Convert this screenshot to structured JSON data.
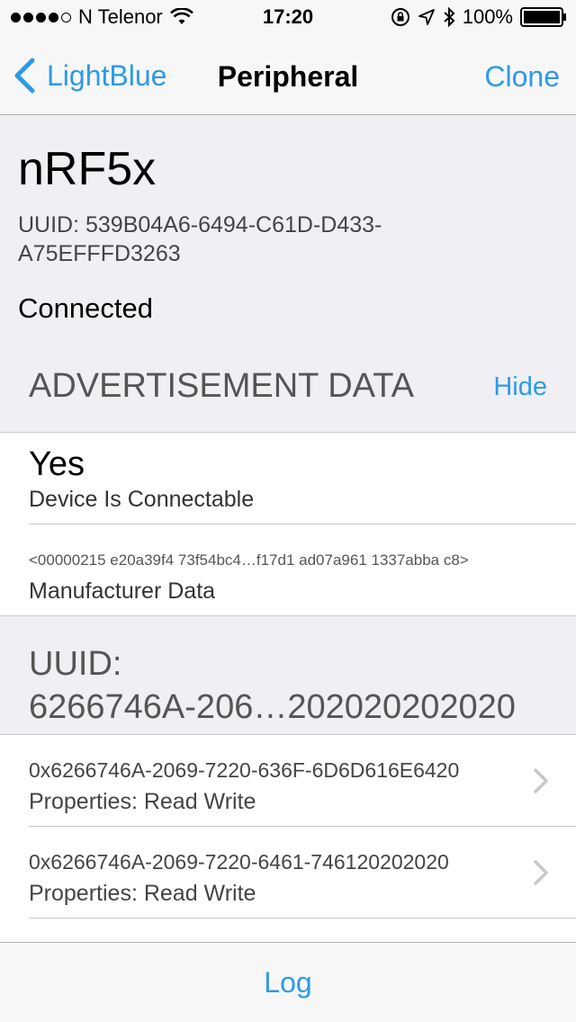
{
  "status_bar": {
    "carrier": "N Telenor",
    "time": "17:20",
    "battery": "100%",
    "signal_bars_filled": 4,
    "signal_bars_total": 5
  },
  "nav": {
    "back_label": "LightBlue",
    "title": "Peripheral",
    "clone_label": "Clone"
  },
  "device": {
    "name": "nRF5x",
    "uuid_line1": "UUID: 539B04A6-6494-C61D-D433-",
    "uuid_line2": "A75EFFFD3263",
    "status": "Connected"
  },
  "advertisement": {
    "header": "ADVERTISEMENT DATA",
    "hide_label": "Hide",
    "rows": [
      {
        "value": "Yes",
        "key": "Device Is Connectable"
      },
      {
        "value": "<00000215 e20a39f4 73f54bc4…f17d1 ad07a961 1337abba c8>",
        "key": "Manufacturer Data"
      }
    ]
  },
  "service": {
    "header_line1": "UUID:",
    "header_line2": "6266746A-206…202020202020",
    "characteristics": [
      {
        "uuid": "0x6266746A-2069-7220-636F-6D6D616E6420",
        "properties": "Properties: Read Write"
      },
      {
        "uuid": "0x6266746A-2069-7220-6461-746120202020",
        "properties": "Properties: Read Write"
      }
    ]
  },
  "toolbar": {
    "log_label": "Log"
  },
  "colors": {
    "accent": "#2e9ae6",
    "background": "#efeff4",
    "bar": "#f7f7f8"
  }
}
